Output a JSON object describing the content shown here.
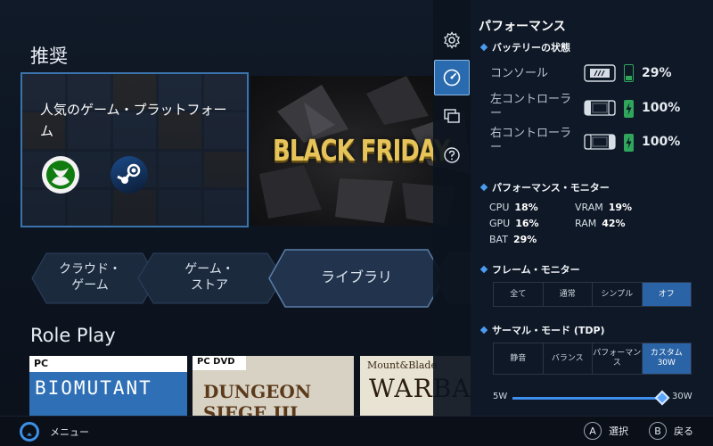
{
  "home": {
    "recommended_title": "推奨",
    "feature": {
      "title": "人気のゲーム・プラットフォーム"
    },
    "banner": {
      "text": "BLACK FRIDAY"
    },
    "nav": [
      {
        "label": "クラウド・\nゲーム"
      },
      {
        "label": "ゲーム・\nストア"
      },
      {
        "label": "ライブラリ"
      }
    ],
    "roleplay_title": "Role Play",
    "covers": [
      {
        "badge": "PC",
        "name": "BIOMUTANT"
      },
      {
        "badge": "PC DVD",
        "name": "DUNGEON SIEGE III"
      },
      {
        "small": "Mount&Blade",
        "name": "WARBA"
      }
    ]
  },
  "rail": {
    "icons": [
      "gear-icon",
      "speedometer-icon",
      "windows-icon",
      "help-icon"
    ]
  },
  "panel": {
    "title": "パフォーマンス",
    "battery": {
      "heading": "バッテリーの状態",
      "rows": [
        {
          "name": "コンソール",
          "percent": "29%",
          "level": 0.29,
          "charging": false
        },
        {
          "name": "左コントローラー",
          "percent": "100%",
          "level": 1.0,
          "charging": true
        },
        {
          "name": "右コントローラー",
          "percent": "100%",
          "level": 1.0,
          "charging": true
        }
      ]
    },
    "monitor": {
      "heading": "パフォーマンス・モニター",
      "items": [
        {
          "key": "CPU",
          "value": "18%"
        },
        {
          "key": "VRAM",
          "value": "19%"
        },
        {
          "key": "GPU",
          "value": "16%"
        },
        {
          "key": "RAM",
          "value": "42%"
        },
        {
          "key": "BAT",
          "value": "29%"
        }
      ]
    },
    "frame": {
      "heading": "フレーム・モニター",
      "options": [
        "全て",
        "通常",
        "シンプル",
        "オフ"
      ],
      "selected": "オフ"
    },
    "thermal": {
      "heading": "サーマル・モード (TDP)",
      "options": [
        "静音",
        "バランス",
        "パフォーマンス",
        "カスタム 30W"
      ],
      "selected": "カスタム 30W"
    },
    "tdp_slider": {
      "min_label": "5W",
      "max_label": "30W",
      "min": 5,
      "max": 30,
      "value": 30
    }
  },
  "bottombar": {
    "menu_label": "メニュー",
    "select": {
      "key": "A",
      "label": "選択"
    },
    "back": {
      "key": "B",
      "label": "戻る"
    }
  },
  "colors": {
    "accent": "#2a64a6",
    "battery_green": "#2fa65b",
    "feature_border": "#3b74ad"
  }
}
